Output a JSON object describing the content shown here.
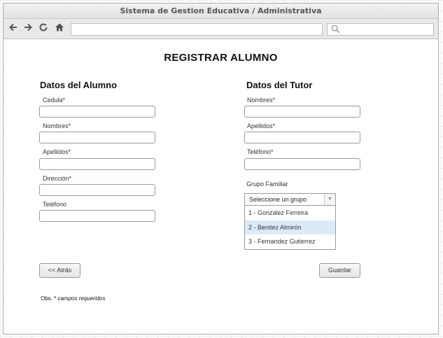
{
  "window": {
    "title": "Sistema de Gestion Educativa / Administrativa"
  },
  "toolbar": {
    "back_icon": "arrow-left-icon",
    "forward_icon": "arrow-right-icon",
    "reload_icon": "reload-icon",
    "home_icon": "home-icon",
    "url_value": "",
    "search_value": ""
  },
  "page": {
    "title": "REGISTRAR ALUMNO"
  },
  "alumno": {
    "section_title": "Datos del Alumno",
    "fields": [
      {
        "label": "Cedula*",
        "value": ""
      },
      {
        "label": "Nombres*",
        "value": ""
      },
      {
        "label": "Apellidos*",
        "value": ""
      },
      {
        "label": "Dirección*",
        "value": ""
      },
      {
        "label": "Teléfono",
        "value": ""
      }
    ]
  },
  "tutor": {
    "section_title": "Datos del Tutor",
    "fields": [
      {
        "label": "Nombres*",
        "value": ""
      },
      {
        "label": "Apellidos*",
        "value": ""
      },
      {
        "label": "Teléfono*",
        "value": ""
      }
    ],
    "grupo_label": "Grupo Familiar",
    "grupo_placeholder": "Seleccione un grupo",
    "grupo_options": [
      {
        "label": "1 - Gonzalez Ferreira",
        "selected": false
      },
      {
        "label": "2  - Benitez Almirón",
        "selected": true
      },
      {
        "label": "3 - Fernandez Gutierrez",
        "selected": false
      }
    ]
  },
  "buttons": {
    "back_label": "<< Atrás",
    "save_label": "Guardar"
  },
  "footer": {
    "obs_prefix": "Obs. * ",
    "obs_italic": "campos requeridos"
  },
  "colors": {
    "selected_option_bg": "#dbeaf7",
    "border": "#9a9a9a"
  }
}
